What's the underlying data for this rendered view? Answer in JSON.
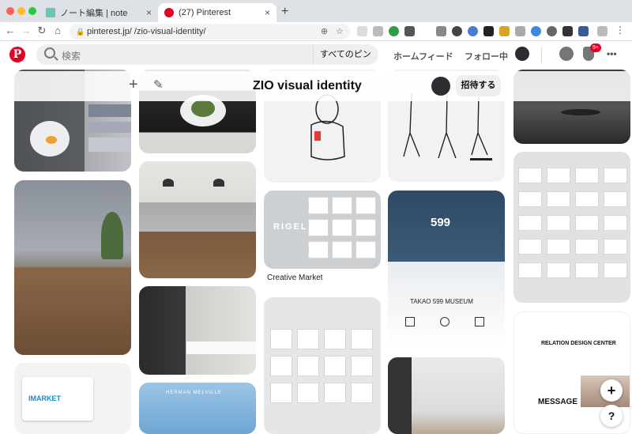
{
  "browser": {
    "tabs": [
      {
        "title": "ノート編集 | note",
        "favicon_color": "#6fc4b8"
      },
      {
        "title": "(27) Pinterest",
        "favicon_color": "#e60023"
      }
    ],
    "new_tab": "+",
    "close": "×",
    "url": "pinterest.jp/          /zio-visual-identity/",
    "nav": {
      "back": "←",
      "forward": "→",
      "reload": "↻",
      "home": "⌂"
    }
  },
  "header": {
    "logo": "P",
    "search_placeholder": "検索",
    "scope": "すべてのピン",
    "home_feed": "ホームフィード",
    "following": "フォロー中",
    "notifications_badge": "9+",
    "more": "•••"
  },
  "board": {
    "title": "ZIO visual identity",
    "invite": "招待する",
    "add": "+",
    "edit": "✎"
  },
  "pins": {
    "rigel_caption": "Creative Market",
    "imarket_text": "IMARKET",
    "museum_title": "TAKAO 599 MUSEUM",
    "museum_number": "599",
    "relation_title": "RELATION DESIGN CENTER",
    "relation_message": "MESSAGE",
    "rigel_title": "RIGEL",
    "herman": "HERMAN MELVILLE"
  },
  "fab": {
    "add": "+",
    "help": "?"
  }
}
